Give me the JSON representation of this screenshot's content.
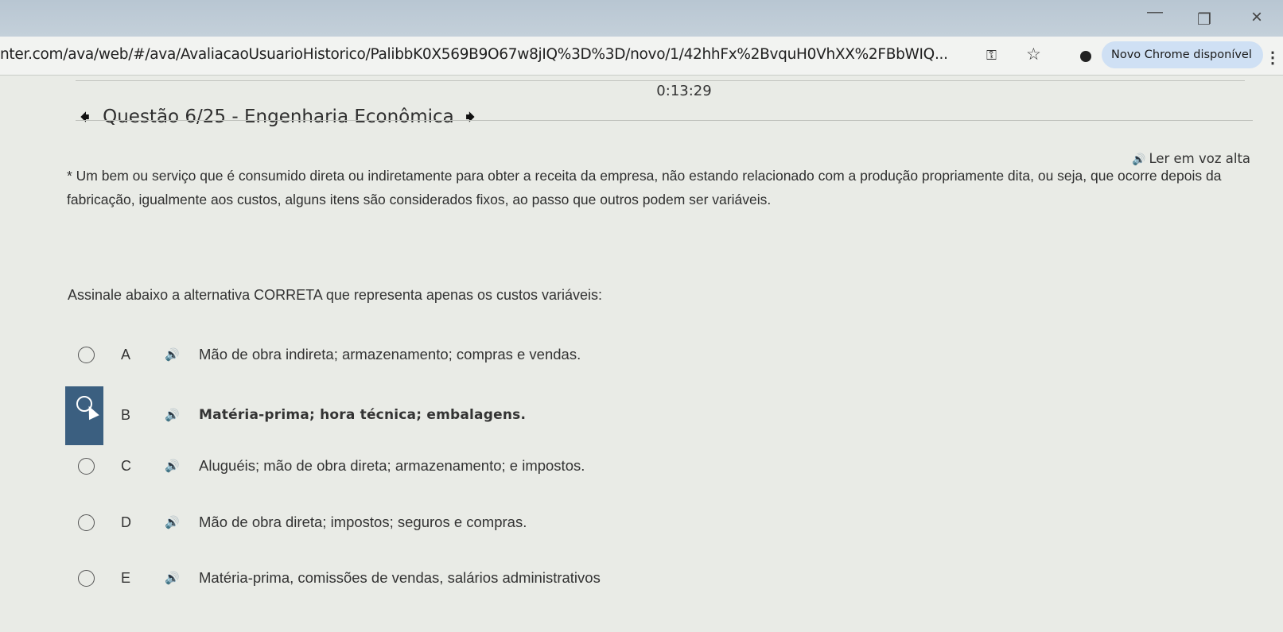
{
  "browser": {
    "url": "nter.com/ava/web/#/ava/AvaliacaoUsuarioHistorico/PalibbK0X569B9O67w8jIQ%3D%3D/novo/1/42hhFx%2BvquH0VhXX%2FBbWIQ...",
    "new_chrome_label": "Novo Chrome disponível"
  },
  "exam": {
    "timer": "0:13:29",
    "question_title": "Questão 6/25 - Engenharia Econômica",
    "read_aloud_label": "Ler em voz alta",
    "stem": "* Um bem ou serviço que é consumido direta ou indiretamente para obter a receita da empresa, não estando relacionado com a produção propriamente dita, ou seja, que ocorre depois da fabricação, igualmente aos custos, alguns itens são considerados fixos, ao passo que outros podem ser variáveis.",
    "prompt": "Assinale abaixo a alternativa CORRETA que representa apenas os custos variáveis:",
    "options": [
      {
        "letter": "A",
        "text": "Mão de obra indireta; armazenamento; compras e vendas."
      },
      {
        "letter": "B",
        "text": "Matéria-prima; hora técnica; embalagens."
      },
      {
        "letter": "C",
        "text": "Aluguéis; mão de obra direta; armazenamento; e impostos."
      },
      {
        "letter": "D",
        "text": "Mão de obra direta; impostos; seguros e compras."
      },
      {
        "letter": "E",
        "text": "Matéria-prima, comissões de vendas, salários administrativos"
      }
    ],
    "selected_option": "B"
  }
}
